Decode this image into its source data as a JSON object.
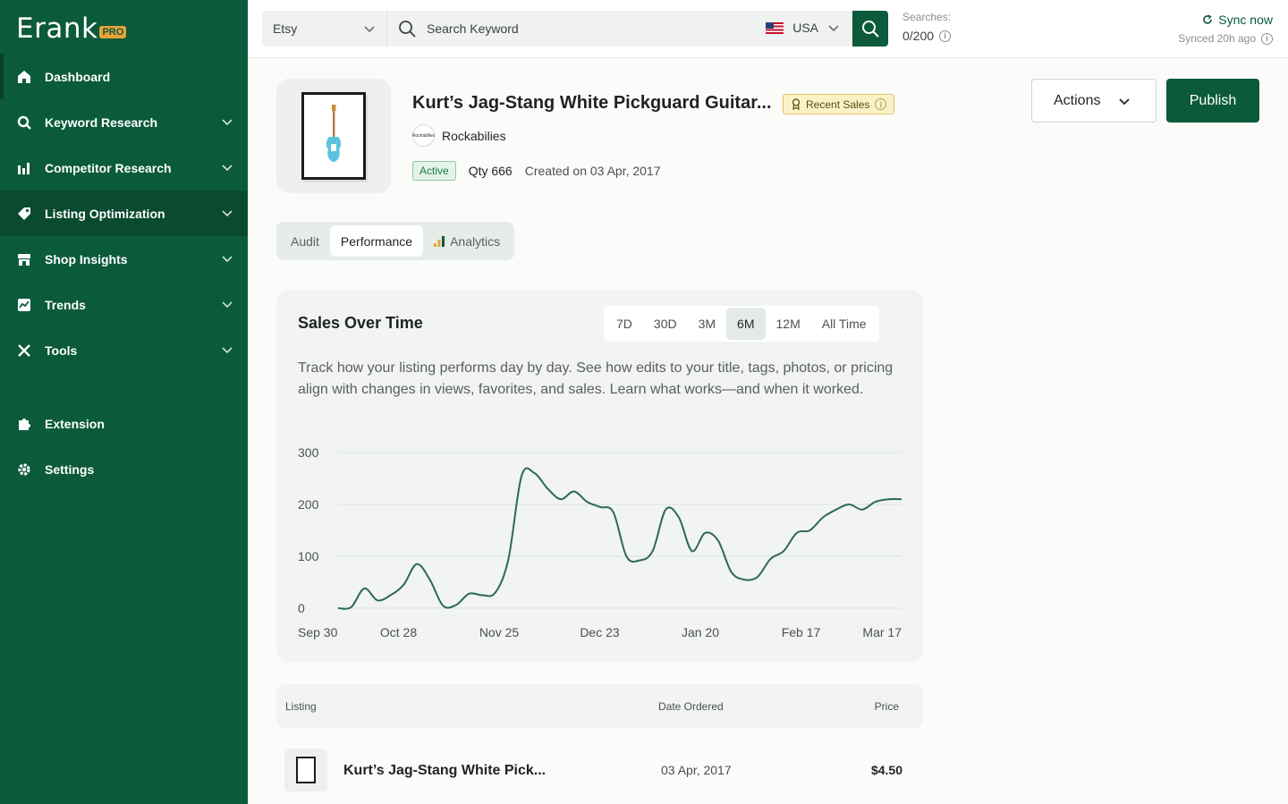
{
  "brand": {
    "name": "Erank",
    "tier": "PRO"
  },
  "sidebar": {
    "items": [
      {
        "label": "Dashboard",
        "icon": "home-icon",
        "chevron": false
      },
      {
        "label": "Keyword Research",
        "icon": "search-icon",
        "chevron": true
      },
      {
        "label": "Competitor Research",
        "icon": "bar-chart-icon",
        "chevron": true
      },
      {
        "label": "Listing Optimization",
        "icon": "tag-icon",
        "chevron": true
      },
      {
        "label": "Shop Insights",
        "icon": "store-icon",
        "chevron": true
      },
      {
        "label": "Trends",
        "icon": "trend-chart-icon",
        "chevron": true
      },
      {
        "label": "Tools",
        "icon": "tools-icon",
        "chevron": true
      }
    ],
    "bottom_items": [
      {
        "label": "Extension",
        "icon": "puzzle-icon"
      },
      {
        "label": "Settings",
        "icon": "gear-icon"
      }
    ]
  },
  "topbar": {
    "marketplace": "Etsy",
    "search_placeholder": "Search Keyword",
    "country": "USA",
    "searches_label": "Searches:",
    "searches_count": "0/200",
    "sync_label": "Sync now",
    "synced_text": "Synced 20h ago"
  },
  "listing": {
    "title": "Kurt’s Jag-Stang White Pickguard Guitar...",
    "badge": "Recent Sales",
    "shop": "Rockabilies",
    "shop_avatar_text": "Rockabilies",
    "status": "Active",
    "qty": "Qty 666",
    "created": "Created on 03 Apr, 2017"
  },
  "actions": {
    "actions_label": "Actions",
    "publish_label": "Publish"
  },
  "tabs": [
    "Audit",
    "Performance",
    "Analytics"
  ],
  "active_tab": "Performance",
  "sales_card": {
    "title": "Sales Over Time",
    "ranges": [
      "7D",
      "30D",
      "3M",
      "6M",
      "12M",
      "All Time"
    ],
    "active_range": "6M",
    "description": "Track how your listing performs day by day. See how edits to your title, tags, photos, or pricing align with changes in views, favorites, and sales. Learn what works—and when it worked."
  },
  "chart_data": {
    "type": "line",
    "x": [
      "Sep 30",
      "Oct 4",
      "Oct 8",
      "Oct 11",
      "Oct 15",
      "Oct 19",
      "Oct 23",
      "Oct 28",
      "Nov 1",
      "Nov 5",
      "Nov 9",
      "Nov 13",
      "Nov 17",
      "Nov 21",
      "Nov 25",
      "Nov 28",
      "Dec 2",
      "Dec 6",
      "Dec 10",
      "Dec 14",
      "Dec 18",
      "Dec 22",
      "Dec 25",
      "Dec 29",
      "Jan 2",
      "Jan 6",
      "Jan 10",
      "Jan 14",
      "Jan 18",
      "Jan 22",
      "Jan 26",
      "Jan 30",
      "Feb 3",
      "Feb 7",
      "Feb 11",
      "Feb 15",
      "Feb 19",
      "Feb 23",
      "Feb 27",
      "Mar 3",
      "Mar 7",
      "Mar 11",
      "Mar 15",
      "Mar 17"
    ],
    "x_tick_labels": [
      "Sep 30",
      "Oct 28",
      "Nov 25",
      "Dec 23",
      "Jan 20",
      "Feb 17",
      "Mar 17"
    ],
    "series": [
      {
        "values": [
          0,
          2,
          38,
          15,
          25,
          45,
          85,
          55,
          5,
          6,
          28,
          25,
          30,
          95,
          255,
          260,
          230,
          210,
          225,
          205,
          195,
          185,
          100,
          92,
          110,
          190,
          175,
          110,
          145,
          130,
          70,
          55,
          60,
          95,
          110,
          145,
          150,
          175,
          190,
          200,
          190,
          205,
          210,
          210
        ]
      }
    ],
    "ylim": [
      0,
      300
    ],
    "y_ticks": [
      0,
      100,
      200,
      300
    ],
    "grid": true,
    "color": "#2c6a4f"
  },
  "table": {
    "headers": [
      "Listing",
      "Date Ordered",
      "Price"
    ],
    "rows": [
      {
        "listing": "Kurt’s Jag-Stang White Pick...",
        "date": "03 Apr, 2017",
        "price": "$4.50"
      }
    ]
  },
  "colors": {
    "primary": "#0b5a3b",
    "card_bg": "#f1f4f2",
    "line": "#2c6a4f"
  }
}
